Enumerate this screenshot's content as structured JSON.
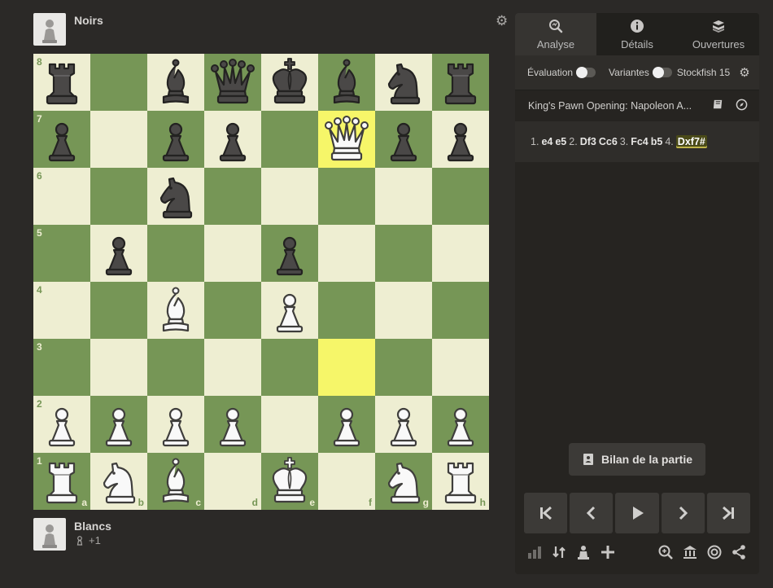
{
  "players": {
    "top": {
      "name": "Noirs",
      "avatar": "pawn-avatar"
    },
    "bottom": {
      "name": "Blancs",
      "avatar": "pawn-avatar",
      "material": "+1"
    }
  },
  "board": {
    "orientation": "white",
    "ranks": [
      "8",
      "7",
      "6",
      "5",
      "4",
      "3",
      "2",
      "1"
    ],
    "files": [
      "a",
      "b",
      "c",
      "d",
      "e",
      "f",
      "g",
      "h"
    ],
    "highlight": [
      "f7",
      "f3"
    ],
    "pieces": {
      "a8": "bR",
      "c8": "bB",
      "d8": "bQ",
      "e8": "bK",
      "f8": "bB",
      "g8": "bN",
      "h8": "bR",
      "a7": "bP",
      "c7": "bP",
      "d7": "bP",
      "f7": "wQ",
      "g7": "bP",
      "h7": "bP",
      "c6": "bN",
      "b5": "bP",
      "e5": "bP",
      "c4": "wB",
      "e4": "wP",
      "a2": "wP",
      "b2": "wP",
      "c2": "wP",
      "d2": "wP",
      "f2": "wP",
      "g2": "wP",
      "h2": "wP",
      "a1": "wR",
      "b1": "wN",
      "c1": "wB",
      "e1": "wK",
      "g1": "wN",
      "h1": "wR"
    }
  },
  "panel": {
    "tabs": [
      {
        "label": "Analyse",
        "icon": "analysis-magnifier-icon",
        "active": true
      },
      {
        "label": "Détails",
        "icon": "info-icon",
        "active": false
      },
      {
        "label": "Ouvertures",
        "icon": "openings-book-icon",
        "active": false
      }
    ],
    "settings": {
      "evaluation_label": "Évaluation",
      "variants_label": "Variantes",
      "engine_label": "Stockfish 15"
    },
    "opening_name": "King's Pawn Opening: Napoleon A...",
    "moves": [
      {
        "num": "1.",
        "white": "e4",
        "black": "e5"
      },
      {
        "num": "2.",
        "white": "Df3",
        "black": "Cc6"
      },
      {
        "num": "3.",
        "white": "Fc4",
        "black": "b5"
      },
      {
        "num": "4.",
        "white": "Dxf7#",
        "black": ""
      }
    ],
    "review_button": "Bilan de la partie"
  }
}
